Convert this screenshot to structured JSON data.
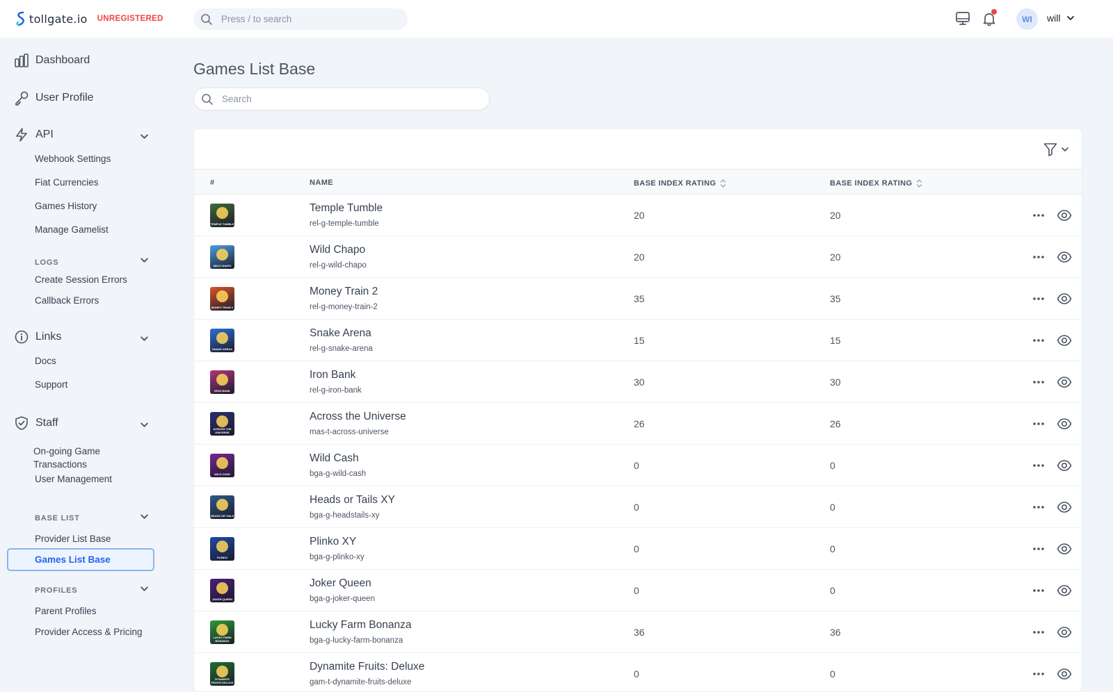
{
  "header": {
    "brand": "tollgate.io",
    "badge": "UNREGISTERED",
    "search_placeholder": "Press / to search",
    "avatar_initials": "WI",
    "username": "will",
    "icons": [
      "monitor-icon",
      "bell-icon",
      "chevron-down-icon"
    ],
    "colors": {
      "badge": "#ef4444",
      "notification_dot": "#ef4444",
      "accent": "#2563eb"
    }
  },
  "sidebar": {
    "dashboard": "Dashboard",
    "user_profile": "User Profile",
    "api": "API",
    "api_items": [
      "Webhook Settings",
      "Fiat Currencies",
      "Games History",
      "Manage Gamelist"
    ],
    "logs_group": "LOGS",
    "logs_items": [
      "Create Session Errors",
      "Callback Errors"
    ],
    "links": "Links",
    "links_items": [
      "Docs",
      "Support"
    ],
    "staff": "Staff",
    "staff_items": [
      "On-going Game Transactions",
      "User Management"
    ],
    "base_list_group": "BASE LIST",
    "base_list_items": [
      "Provider List Base",
      "Games List Base"
    ],
    "profiles_group": "PROFILES",
    "profiles_items": [
      "Parent Profiles",
      "Provider Access & Pricing"
    ],
    "active_item": "Games List Base"
  },
  "main": {
    "title": "Games List Base",
    "search_placeholder": "Search",
    "table": {
      "columns": [
        "#",
        "NAME",
        "BASE INDEX RATING",
        "BASE INDEX RATING"
      ],
      "rows": [
        {
          "name": "Temple Tumble",
          "slug": "rel-g-temple-tumble",
          "rating1": "20",
          "rating2": "20",
          "thumb_text": "TEMPLE TUMBLE",
          "thumb_color": "#3f6b3a"
        },
        {
          "name": "Wild Chapo",
          "slug": "rel-g-wild-chapo",
          "rating1": "20",
          "rating2": "20",
          "thumb_text": "WILD CHAPO",
          "thumb_color": "#4a9fe0"
        },
        {
          "name": "Money Train 2",
          "slug": "rel-g-money-train-2",
          "rating1": "35",
          "rating2": "35",
          "thumb_text": "MONEY TRAIN 2",
          "thumb_color": "#d9552a"
        },
        {
          "name": "Snake Arena",
          "slug": "rel-g-snake-arena",
          "rating1": "15",
          "rating2": "15",
          "thumb_text": "SNAKE ARENA",
          "thumb_color": "#2f6fd6"
        },
        {
          "name": "Iron Bank",
          "slug": "rel-g-iron-bank",
          "rating1": "30",
          "rating2": "30",
          "thumb_text": "IRON BANK",
          "thumb_color": "#b0377a"
        },
        {
          "name": "Across the Universe",
          "slug": "mas-t-across-universe",
          "rating1": "26",
          "rating2": "26",
          "thumb_text": "ACROSS THE UNIVERSE",
          "thumb_color": "#2a2f6e"
        },
        {
          "name": "Wild Cash",
          "slug": "bga-g-wild-cash",
          "rating1": "0",
          "rating2": "0",
          "thumb_text": "WILD CASH",
          "thumb_color": "#7a2596"
        },
        {
          "name": "Heads or Tails XY",
          "slug": "bga-g-headstails-xy",
          "rating1": "0",
          "rating2": "0",
          "thumb_text": "HEADS OR TAILS",
          "thumb_color": "#2d5a8c"
        },
        {
          "name": "Plinko XY",
          "slug": "bga-g-plinko-xy",
          "rating1": "0",
          "rating2": "0",
          "thumb_text": "PLINKO",
          "thumb_color": "#1f4aa8"
        },
        {
          "name": "Joker Queen",
          "slug": "bga-g-joker-queen",
          "rating1": "0",
          "rating2": "0",
          "thumb_text": "JOKER QUEEN",
          "thumb_color": "#4b1f7a"
        },
        {
          "name": "Lucky Farm Bonanza",
          "slug": "bga-g-lucky-farm-bonanza",
          "rating1": "36",
          "rating2": "36",
          "thumb_text": "LUCKY FARM BONANZA",
          "thumb_color": "#2f9a3a"
        },
        {
          "name": "Dynamite Fruits: Deluxe",
          "slug": "gam-t-dynamite-fruits-deluxe",
          "rating1": "0",
          "rating2": "0",
          "thumb_text": "DYNAMITE FRUITS DELUXE",
          "thumb_color": "#1f6e2e"
        }
      ]
    }
  }
}
